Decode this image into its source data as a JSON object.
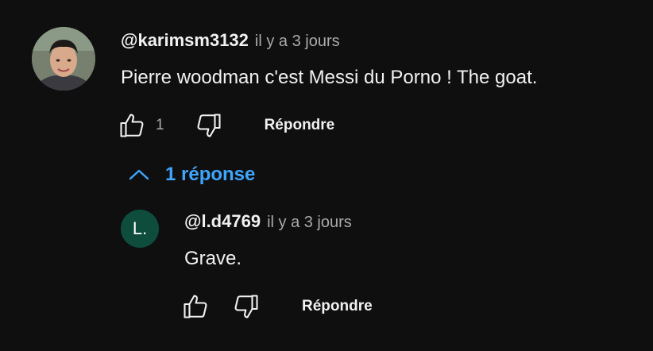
{
  "comment": {
    "handle": "@karimsm3132",
    "time": "il y a 3 jours",
    "text": "Pierre woodman c'est Messi du Porno ! The goat.",
    "likes": "1",
    "reply_label": "Répondre"
  },
  "replies_toggle": {
    "label": "1 réponse"
  },
  "reply": {
    "avatar_letter": "L.",
    "handle": "@l.d4769",
    "time": "il y a 3 jours",
    "text": "Grave.",
    "reply_label": "Répondre"
  },
  "colors": {
    "background": "#0f0f0f",
    "text": "#f1f1f1",
    "muted": "#aaaaaa",
    "link": "#3ea6ff",
    "reply_avatar": "#0e4d3c"
  },
  "icons": {
    "like": "thumbs-up-icon",
    "dislike": "thumbs-down-icon",
    "toggle": "chevron-up-icon"
  }
}
